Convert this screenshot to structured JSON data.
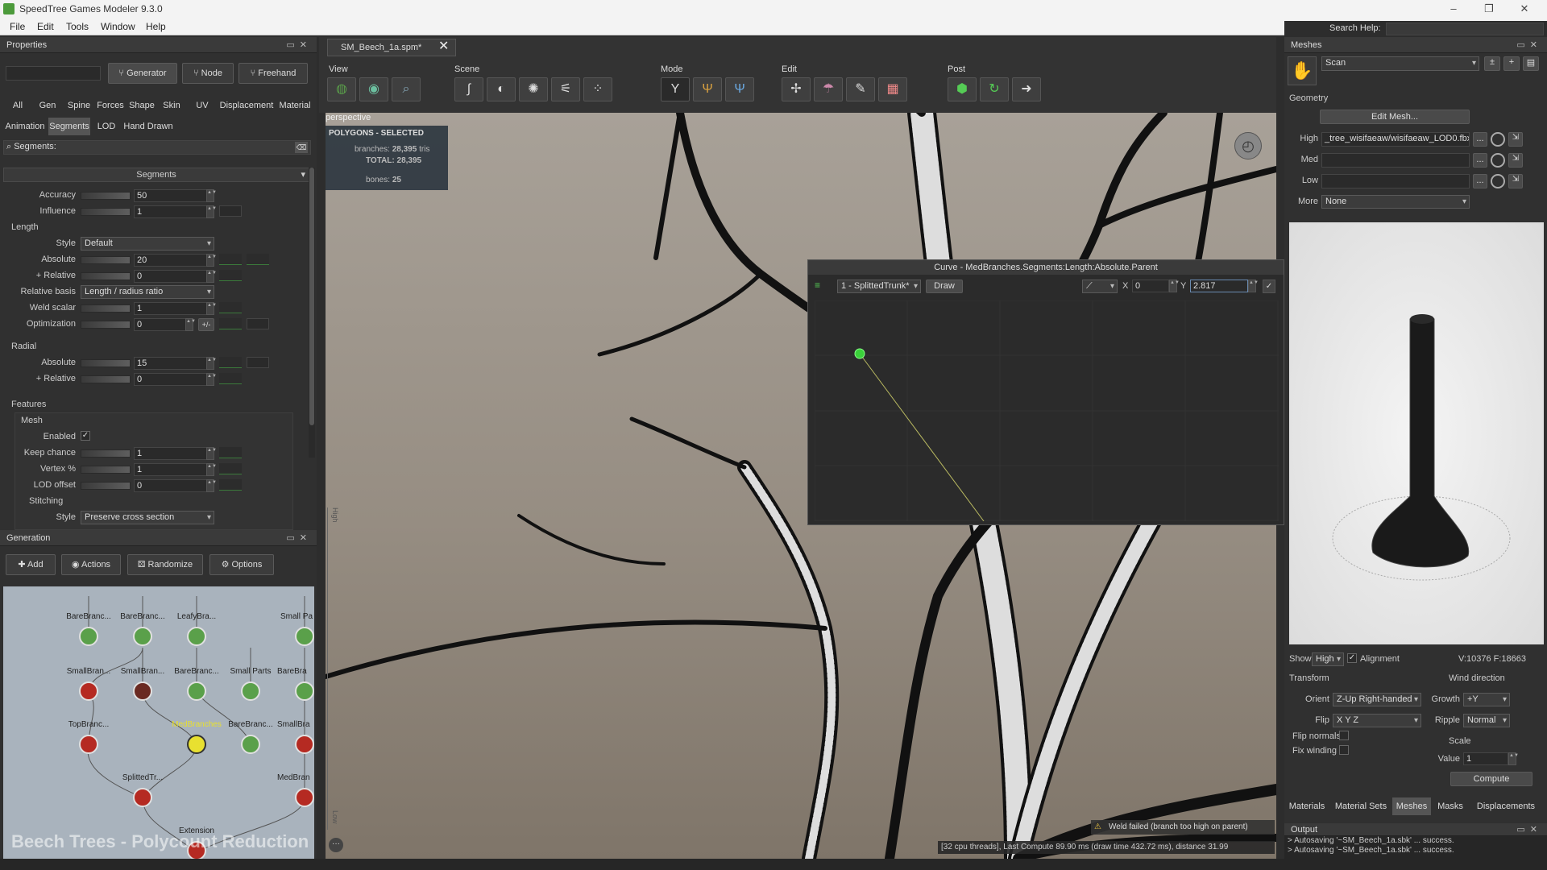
{
  "app": {
    "title": "SpeedTree Games Modeler 9.3.0"
  },
  "window_controls": {
    "minimize": "–",
    "restore": "❐",
    "close": "✕"
  },
  "menu": [
    "File",
    "Edit",
    "Tools",
    "Window",
    "Help"
  ],
  "properties": {
    "title": "Properties",
    "mode_buttons": [
      "Generator",
      "Node",
      "Freehand"
    ],
    "tabs_row1": [
      "All",
      "Gen",
      "Spine",
      "Forces",
      "Shape",
      "Skin",
      "UV",
      "Displacement",
      "Material"
    ],
    "tabs_row2": [
      "Animation",
      "Segments",
      "LOD",
      "Hand Drawn"
    ],
    "selected_tab": "Segments",
    "search_placeholder": "Segments:",
    "section_title": "Segments",
    "rows": {
      "accuracy": {
        "label": "Accuracy",
        "value": "50"
      },
      "influence": {
        "label": "Influence",
        "value": "1"
      },
      "length_header": "Length",
      "style": {
        "label": "Style",
        "value": "Default"
      },
      "absolute": {
        "label": "Absolute",
        "value": "20"
      },
      "relative": {
        "label": "+ Relative",
        "value": "0"
      },
      "relative_basis": {
        "label": "Relative basis",
        "value": "Length / radius ratio"
      },
      "weld_scalar": {
        "label": "Weld scalar",
        "value": "1"
      },
      "optimization": {
        "label": "Optimization",
        "value": "0",
        "extra": "+/-"
      },
      "radial_header": "Radial",
      "r_absolute": {
        "label": "Absolute",
        "value": "15"
      },
      "r_relative": {
        "label": "+ Relative",
        "value": "0"
      },
      "features_header": "Features",
      "mesh_header": "Mesh",
      "enabled": {
        "label": "Enabled",
        "checked": "✓"
      },
      "keep_chance": {
        "label": "Keep chance",
        "value": "1"
      },
      "vertex_pct": {
        "label": "Vertex %",
        "value": "1"
      },
      "lod_offset": {
        "label": "LOD offset",
        "value": "0"
      },
      "stitching_header": "Stitching",
      "stitch_style": {
        "label": "Style",
        "value": "Preserve cross section"
      }
    }
  },
  "generation": {
    "title": "Generation",
    "buttons": [
      "Add",
      "Actions",
      "Randomize",
      "Options"
    ],
    "nodes": [
      {
        "label": "BareBranc...",
        "color": "g"
      },
      {
        "label": "BareBranc...",
        "color": "g"
      },
      {
        "label": "LeafyBra...",
        "color": "g"
      },
      {
        "label": "Small Pa",
        "color": "g"
      },
      {
        "label": "SmallBran...",
        "color": "r"
      },
      {
        "label": "SmallBran...",
        "color": "dr"
      },
      {
        "label": "BareBranc...",
        "color": "g"
      },
      {
        "label": "Small Parts",
        "color": "g"
      },
      {
        "label": "BareBra",
        "color": "g"
      },
      {
        "label": "TopBranc...",
        "color": "r"
      },
      {
        "label": "MedBranches",
        "color": "y"
      },
      {
        "label": "BareBranc...",
        "color": "g"
      },
      {
        "label": "SmallBra",
        "color": "r"
      },
      {
        "label": "SplittedTr...",
        "color": "r"
      },
      {
        "label": "MedBran",
        "color": "r"
      },
      {
        "label": "Extension",
        "color": "r"
      }
    ],
    "watermark": "Beech Trees - Polycount Reduction"
  },
  "document_tab": {
    "name": "SM_Beech_1a.spm*",
    "close": "✕"
  },
  "toolbar": {
    "groups": [
      "View",
      "Scene",
      "Mode",
      "Edit",
      "Post"
    ]
  },
  "viewport": {
    "camera": "perspective",
    "stats_title": "POLYGONS - SELECTED",
    "branches_label": "branches:",
    "branches_value": "28,395",
    "branches_unit": "tris",
    "total_label": "TOTAL:",
    "total_value": "28,395",
    "bones_label": "bones:",
    "bones_value": "25",
    "warning": "Weld failed (branch too high on parent)",
    "status": "[32 cpu threads], Last Compute 89.90 ms (draw time 432.72 ms), distance 31.99",
    "ruler_high": "High",
    "ruler_low": "Low"
  },
  "curve_editor": {
    "title": "Curve - MedBranches.Segments:Length:Absolute.Parent",
    "preset": "1 - SplittedTrunk*",
    "draw_button": "Draw",
    "x_label": "X",
    "x_value": "0",
    "y_label": "Y",
    "y_value": "2.817"
  },
  "meshes": {
    "title": "Meshes",
    "source": "Scan",
    "geometry_header": "Geometry",
    "edit_mesh": "Edit Mesh...",
    "high_label": "High",
    "high_value": "_tree_wisifaeaw/wisifaeaw_LOD0.fbx",
    "med_label": "Med",
    "low_label": "Low",
    "more_label": "More",
    "more_value": "None",
    "browse": "..."
  },
  "mesh_settings": {
    "show_label": "Show",
    "show_value": "High",
    "alignment": "Alignment",
    "stats": "V:10376  F:18663",
    "transform_header": "Transform",
    "orient_label": "Orient",
    "orient_value": "Z-Up Right-handed",
    "flip_label": "Flip",
    "flip_value": "X Y Z",
    "flip_normals": "Flip normals",
    "fix_winding": "Fix winding",
    "wind_header": "Wind direction",
    "growth_label": "Growth",
    "growth_value": "+Y",
    "ripple_label": "Ripple",
    "ripple_value": "Normal",
    "scale_header": "Scale",
    "value_label": "Value",
    "value_value": "1",
    "compute": "Compute"
  },
  "bottom_tabs": [
    "Materials",
    "Material Sets",
    "Meshes",
    "Masks",
    "Displacements"
  ],
  "search_help": {
    "label": "Search Help:"
  },
  "output": {
    "title": "Output",
    "lines": [
      "> Autosaving '~SM_Beech_1a.sbk' ... success.",
      "> Autosaving '~SM_Beech_1a.sbk' ... success."
    ]
  }
}
